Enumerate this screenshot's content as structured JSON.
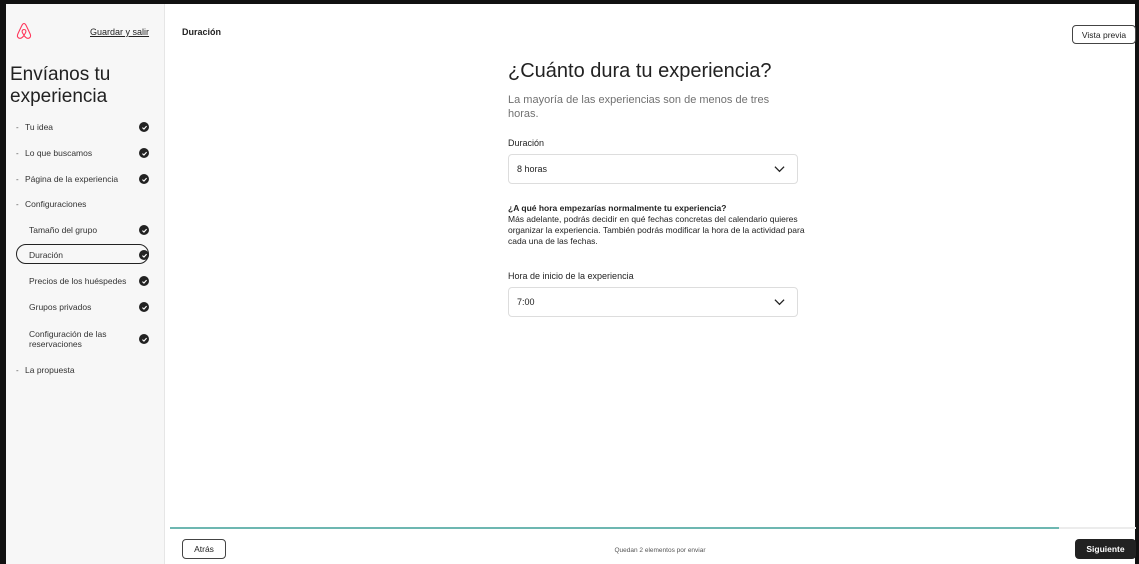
{
  "sidebar": {
    "save_exit": "Guardar y salir",
    "title": "Envíanos tu experiencia",
    "sections": [
      {
        "label": "Tu idea",
        "bullet": "-",
        "completed": true
      },
      {
        "label": "Lo que buscamos",
        "bullet": "-",
        "completed": true
      },
      {
        "label": "Página de la experiencia",
        "bullet": "-",
        "completed": true
      },
      {
        "label": "Configuraciones",
        "bullet": "-",
        "completed": false
      },
      {
        "label": "La propuesta",
        "bullet": "-",
        "completed": false
      }
    ],
    "sub_items": [
      {
        "label": "Tamaño del grupo",
        "completed": true
      },
      {
        "label": "Duración",
        "completed": true,
        "active": true
      },
      {
        "label": "Precios de los huéspedes",
        "completed": true
      },
      {
        "label": "Grupos privados",
        "completed": true
      },
      {
        "label": "Configuración de las reservaciones",
        "completed": true
      }
    ]
  },
  "header": {
    "page_title": "Duración",
    "preview_button": "Vista previa"
  },
  "main": {
    "heading": "¿Cuánto dura tu experiencia?",
    "subheading": "La mayoría de las experiencias son de menos de tres horas.",
    "duration": {
      "label": "Duración",
      "value": "8 horas"
    },
    "question_title": "¿A qué hora empezarías normalmente tu experiencia?",
    "question_desc": "Más adelante, podrás decidir en qué fechas concretas del calendario quieres organizar la experiencia. También podrás modificar la hora de la actividad para cada una de las fechas.",
    "start_time": {
      "label": "Hora de inicio de la experiencia",
      "value": "7:00"
    }
  },
  "footer": {
    "back_button": "Atrás",
    "pending_text": "Quedan 2 elementos por enviar",
    "next_button": "Siguiente",
    "progress_fraction": 0.92
  },
  "colors": {
    "accent": "#6db7b1",
    "dark": "#222222",
    "muted": "#717171"
  },
  "icons": {
    "logo": "airbnb-logo-icon",
    "check": "check-circle-icon",
    "chevron": "chevron-down-icon"
  }
}
